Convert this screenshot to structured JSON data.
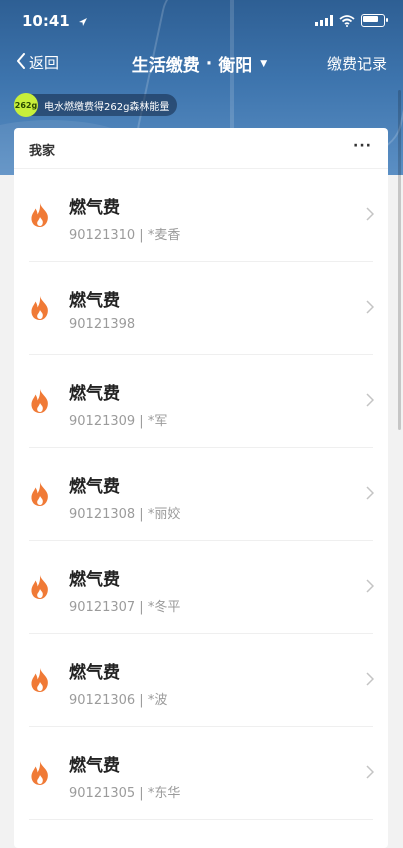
{
  "status_bar": {
    "time": "10:41"
  },
  "nav": {
    "back_label": "返回",
    "title": "生活缴费",
    "separator": "·",
    "city": "衡阳",
    "right_label": "缴费记录"
  },
  "energy_badge": {
    "amount": "262g",
    "text": "电水燃缴费得262g森林能量"
  },
  "card": {
    "title": "我家",
    "more": "···"
  },
  "bills": [
    {
      "name": "燃气费",
      "account": "90121310 | *麦香"
    },
    {
      "name": "燃气费",
      "account": "90121398"
    },
    {
      "name": "燃气费",
      "account": "90121309 | *军"
    },
    {
      "name": "燃气费",
      "account": "90121308 | *丽姣"
    },
    {
      "name": "燃气费",
      "account": "90121307 | *冬平"
    },
    {
      "name": "燃气费",
      "account": "90121306 | *波"
    },
    {
      "name": "燃气费",
      "account": "90121305 | *东华"
    }
  ],
  "colors": {
    "header": "#3d74ad",
    "flame": "#f07a36",
    "badge": "#c7ef3b"
  },
  "icons": [
    "location-arrow-icon",
    "signal-icon",
    "wifi-icon",
    "battery-icon",
    "back-chevron-icon",
    "dropdown-caret-icon",
    "flame-icon",
    "chevron-right-icon"
  ]
}
